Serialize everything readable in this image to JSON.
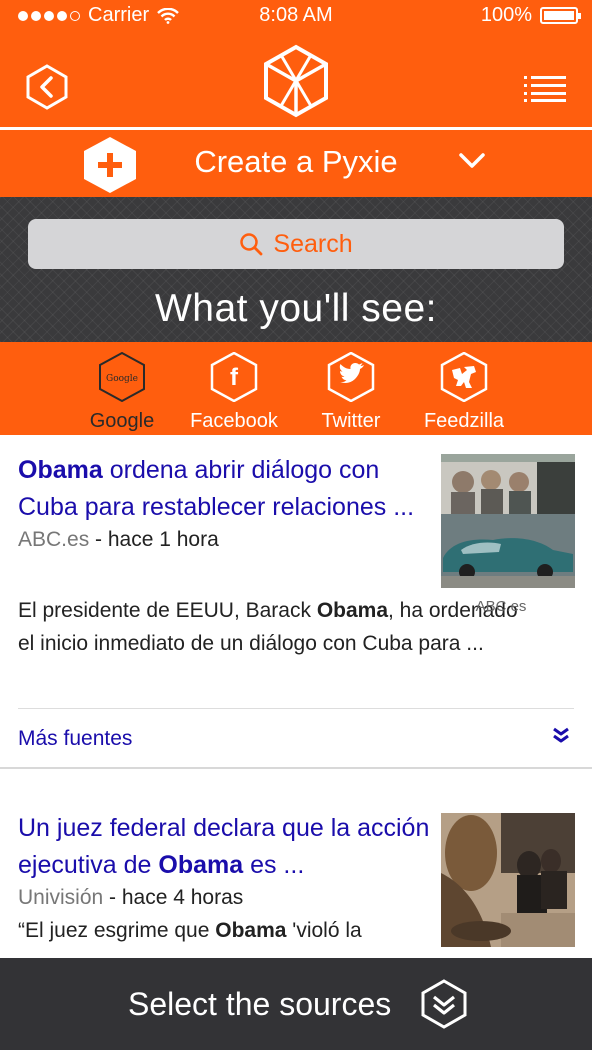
{
  "status_bar": {
    "carrier": "Carrier",
    "time": "8:08 AM",
    "battery": "100%"
  },
  "create": {
    "label": "Create a Pyxie"
  },
  "search": {
    "label": "Search"
  },
  "see_title": "What you'll see:",
  "sources": [
    {
      "label": "Google",
      "icon_text": "Google"
    },
    {
      "label": "Facebook",
      "icon_text": "f"
    },
    {
      "label": "Twitter"
    },
    {
      "label": "Feedzilla"
    }
  ],
  "articles": [
    {
      "headline_bold": "Obama",
      "headline_rest": " ordena abrir diálogo con Cuba para restablecer relaciones ...",
      "source": "ABC.es",
      "time": " - hace 1 hora",
      "snippet_pre": "El presidente de EEUU, Barack ",
      "snippet_bold": "Obama",
      "snippet_post": ", ha ordenado el inicio inmediato de un diálogo con Cuba para ...",
      "thumb_caption": "ABC.es"
    },
    {
      "headline_pre": "Un juez federal declara que la acción ejecutiva de ",
      "headline_bold": "Obama",
      "headline_post": " es ...",
      "source": "Univisión",
      "time": " - hace 4 horas",
      "snippet_pre": "“El juez esgrime que ",
      "snippet_bold": "Obama",
      "snippet_post": " 'violó la"
    }
  ],
  "more_sources": "Más fuentes",
  "bottom_bar": {
    "label": "Select the sources"
  },
  "colors": {
    "accent": "#FF5E0E",
    "link": "#1a0dab",
    "dark": "#333336"
  },
  "icons": [
    "back-icon",
    "pyxie-logo-icon",
    "menu-icon",
    "plus-hex-icon",
    "chevron-down-icon",
    "search-icon",
    "google-hex-icon",
    "facebook-hex-icon",
    "twitter-hex-icon",
    "feedzilla-hex-icon",
    "double-chevron-icon"
  ]
}
